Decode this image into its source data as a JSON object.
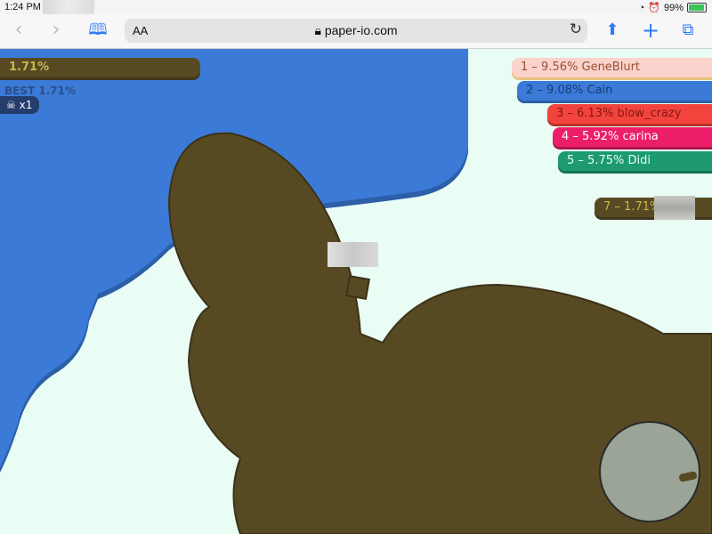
{
  "status_bar": {
    "time": "1:24 PM",
    "battery": "99%"
  },
  "toolbar": {
    "back_icon": "chevron-left-icon",
    "forward_icon": "chevron-right-icon",
    "bookmarks_icon": "open-book-icon",
    "reader_label": "AA",
    "url": "paper-io.com",
    "lock_icon": "lock-icon",
    "reload_icon": "reload-icon",
    "share_icon": "share-icon",
    "new_tab_icon": "plus-icon",
    "tabs_icon": "tabs-icon"
  },
  "hud": {
    "my_percent": "1.71%",
    "best_label": "BEST",
    "best_value": "1.71%",
    "kills": "x1",
    "kills_icon": "skull-icon"
  },
  "leaderboard": [
    {
      "rank": "1",
      "percent": "9.56%",
      "name": "GeneBlurt"
    },
    {
      "rank": "2",
      "percent": "9.08%",
      "name": "Cain"
    },
    {
      "rank": "3",
      "percent": "6.13%",
      "name": "blow_crazy"
    },
    {
      "rank": "4",
      "percent": "5.92%",
      "name": "carina"
    },
    {
      "rank": "5",
      "percent": "5.75%",
      "name": "Didi"
    },
    {
      "rank": "7",
      "percent": "1.71%",
      "name": ""
    }
  ],
  "colors": {
    "background": "#e9fdf5",
    "player": "#574a23",
    "blue_territory": "#3b7ad7",
    "green_territory": "#1d9a72",
    "minimap": "#9aa497"
  }
}
